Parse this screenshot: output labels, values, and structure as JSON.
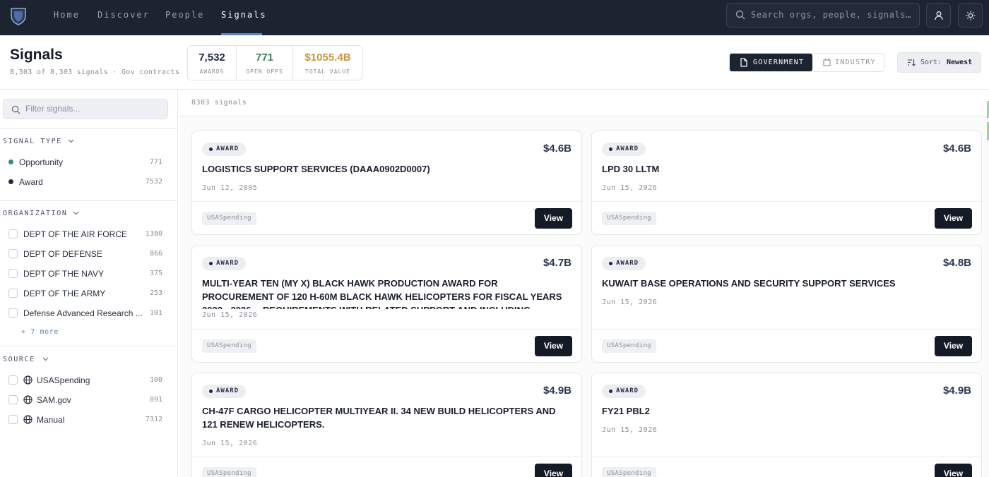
{
  "nav": {
    "links": [
      "Home",
      "Discover",
      "People",
      "Signals"
    ],
    "search_placeholder": "Search orgs, people, signals…"
  },
  "header": {
    "title": "Signals",
    "subtitle": "8,303 of 8,303 signals · Gov contracts",
    "stats": [
      {
        "value": "7,532",
        "label": "AWARDS",
        "color": "#1c2a4a"
      },
      {
        "value": "771",
        "label": "OPEN OPPS",
        "color": "#3d7d5e"
      },
      {
        "value": "$1055.4B",
        "label": "TOTAL VALUE",
        "color": "#c9963a"
      }
    ],
    "segments": [
      "GOVERNMENT",
      "INDUSTRY"
    ],
    "sort_label": "Sort:",
    "sort_value": "Newest"
  },
  "sidebar": {
    "filter_placeholder": "Filter signals...",
    "signal_type": {
      "heading": "SIGNAL TYPE",
      "items": [
        {
          "label": "Opportunity",
          "count": "771",
          "color": "#3d8c68"
        },
        {
          "label": "Award",
          "count": "7532",
          "color": "#1c2a4a"
        }
      ]
    },
    "organization": {
      "heading": "ORGANIZATION",
      "items": [
        {
          "label": "DEPT OF THE AIR FORCE",
          "count": "1380"
        },
        {
          "label": "DEPT OF DEFENSE",
          "count": "866"
        },
        {
          "label": "DEPT OF THE NAVY",
          "count": "375"
        },
        {
          "label": "DEPT OF THE ARMY",
          "count": "253"
        },
        {
          "label": "Defense Advanced Research ...",
          "count": "101"
        }
      ],
      "more": "+ 7 more"
    },
    "source": {
      "heading": "SOURCE",
      "items": [
        {
          "label": "USASpending",
          "count": "100"
        },
        {
          "label": "SAM.gov",
          "count": "891"
        },
        {
          "label": "Manual",
          "count": "7312"
        }
      ]
    }
  },
  "main": {
    "count_text": "8303 signals",
    "cards": [
      {
        "badge": "AWARD",
        "amount": "$4.6B",
        "title": "LOGISTICS SUPPORT SERVICES (DAAA0902D0007)",
        "date": "Jun 12, 2005",
        "tag": "USASpending",
        "button": "View"
      },
      {
        "badge": "AWARD",
        "amount": "$4.6B",
        "title": "LPD 30 LLTM",
        "date": "Jun 15, 2026",
        "tag": "USASpending",
        "button": "View"
      },
      {
        "badge": "AWARD",
        "amount": "$4.7B",
        "title": "MULTI-YEAR TEN (MY X) BLACK HAWK PRODUCTION AWARD FOR PROCUREMENT OF 120 H-60M BLACK HAWK HELICOPTERS FOR FISCAL YEARS 2022 - 2026… REQUIREMENTS WITH RELATED SUPPORT AND INCLUDING OPTIONS FOR AN",
        "date": "Jun 15, 2026",
        "tag": "USASpending",
        "button": "View"
      },
      {
        "badge": "AWARD",
        "amount": "$4.8B",
        "title": "KUWAIT BASE OPERATIONS AND SECURITY SUPPORT SERVICES",
        "date": "Jun 15, 2026",
        "tag": "USASpending",
        "button": "View"
      },
      {
        "badge": "AWARD",
        "amount": "$4.9B",
        "title": "CH-47F CARGO HELICOPTER MULTIYEAR II. 34 NEW BUILD HELICOPTERS AND 121 RENEW HELICOPTERS.",
        "date": "Jun 15, 2026",
        "tag": "USASpending",
        "button": "View"
      },
      {
        "badge": "AWARD",
        "amount": "$4.9B",
        "title": "FY21 PBL2",
        "date": "Jun 15, 2026",
        "tag": "USASpending",
        "button": "View"
      }
    ]
  }
}
